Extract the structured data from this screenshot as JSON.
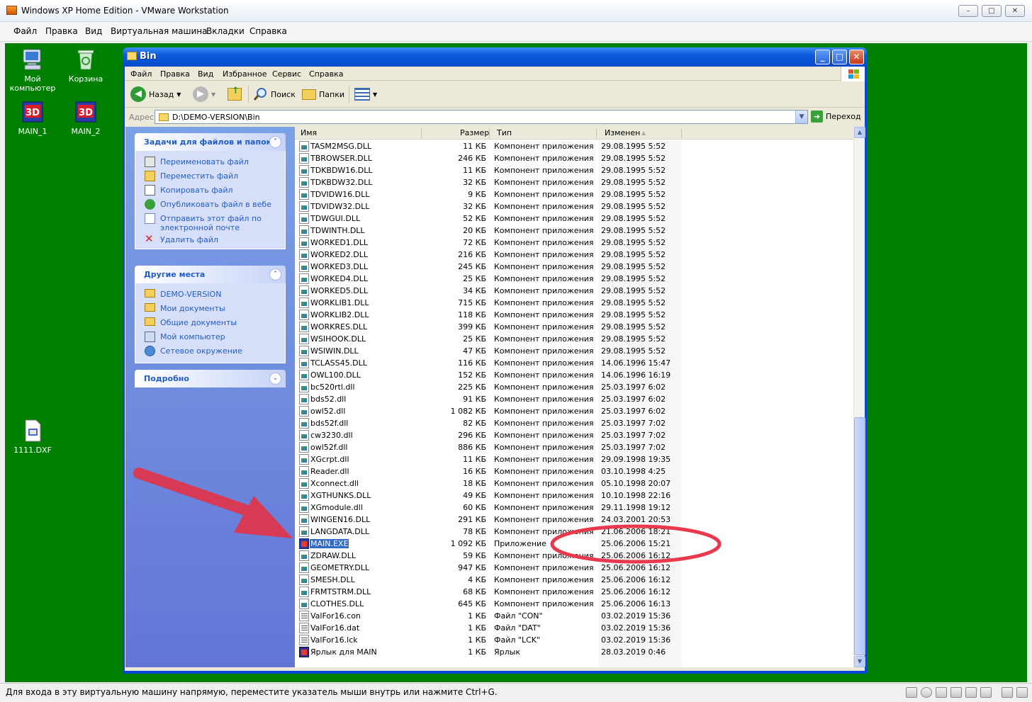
{
  "vm": {
    "title": "Windows XP Home Edition - VMware Workstation",
    "menu": [
      "Файл",
      "Правка",
      "Вид",
      "Виртуальная машина",
      "Вкладки",
      "Справка"
    ],
    "status": "Для входа в эту виртуальную машину напрямую, переместите указатель мыши внутрь или нажмите Ctrl+G."
  },
  "desktop": {
    "icons": [
      {
        "label": "Мой компьютер",
        "icon": "my-computer-icon"
      },
      {
        "label": "Корзина",
        "icon": "recycle-bin-icon"
      },
      {
        "label": "MAIN_1",
        "icon": "3d-app-icon"
      },
      {
        "label": "MAIN_2",
        "icon": "3d-app-icon"
      },
      {
        "label": "1111.DXF",
        "icon": "dxf-file-icon"
      }
    ]
  },
  "explorer": {
    "title": "Bin",
    "menu": [
      "Файл",
      "Правка",
      "Вид",
      "Избранное",
      "Сервис",
      "Справка"
    ],
    "toolbar": {
      "back": "Назад",
      "search": "Поиск",
      "folders": "Папки"
    },
    "address_label": "Адрес:",
    "address": "D:\\DEMO-VERSION\\Bin",
    "go": "Переход",
    "columns": {
      "name": "Имя",
      "size": "Размер",
      "type": "Тип",
      "modified": "Изменен"
    },
    "tasks": {
      "file_tasks": {
        "title": "Задачи для файлов и папок",
        "items": [
          "Переименовать файл",
          "Переместить файл",
          "Копировать файл",
          "Опубликовать файл в вебе",
          "Отправить этот файл по электронной почте",
          "Удалить файл"
        ]
      },
      "other_places": {
        "title": "Другие места",
        "items": [
          "DEMO-VERSION",
          "Мои документы",
          "Общие документы",
          "Мой компьютер",
          "Сетевое окружение"
        ]
      },
      "details": {
        "title": "Подробно"
      }
    },
    "files": [
      {
        "name": "TASM2MSG.DLL",
        "size": "11 КБ",
        "type": "Компонент приложения",
        "modified": "29.08.1995 5:52",
        "kind": "dll"
      },
      {
        "name": "TBROWSER.DLL",
        "size": "246 КБ",
        "type": "Компонент приложения",
        "modified": "29.08.1995 5:52",
        "kind": "dll"
      },
      {
        "name": "TDKBDW16.DLL",
        "size": "11 КБ",
        "type": "Компонент приложения",
        "modified": "29.08.1995 5:52",
        "kind": "dll"
      },
      {
        "name": "TDKBDW32.DLL",
        "size": "32 КБ",
        "type": "Компонент приложения",
        "modified": "29.08.1995 5:52",
        "kind": "dll"
      },
      {
        "name": "TDVIDW16.DLL",
        "size": "9 КБ",
        "type": "Компонент приложения",
        "modified": "29.08.1995 5:52",
        "kind": "dll"
      },
      {
        "name": "TDVIDW32.DLL",
        "size": "32 КБ",
        "type": "Компонент приложения",
        "modified": "29.08.1995 5:52",
        "kind": "dll"
      },
      {
        "name": "TDWGUI.DLL",
        "size": "52 КБ",
        "type": "Компонент приложения",
        "modified": "29.08.1995 5:52",
        "kind": "dll"
      },
      {
        "name": "TDWINTH.DLL",
        "size": "20 КБ",
        "type": "Компонент приложения",
        "modified": "29.08.1995 5:52",
        "kind": "dll"
      },
      {
        "name": "WORKED1.DLL",
        "size": "72 КБ",
        "type": "Компонент приложения",
        "modified": "29.08.1995 5:52",
        "kind": "dll"
      },
      {
        "name": "WORKED2.DLL",
        "size": "216 КБ",
        "type": "Компонент приложения",
        "modified": "29.08.1995 5:52",
        "kind": "dll"
      },
      {
        "name": "WORKED3.DLL",
        "size": "245 КБ",
        "type": "Компонент приложения",
        "modified": "29.08.1995 5:52",
        "kind": "dll"
      },
      {
        "name": "WORKED4.DLL",
        "size": "25 КБ",
        "type": "Компонент приложения",
        "modified": "29.08.1995 5:52",
        "kind": "dll"
      },
      {
        "name": "WORKED5.DLL",
        "size": "34 КБ",
        "type": "Компонент приложения",
        "modified": "29.08.1995 5:52",
        "kind": "dll"
      },
      {
        "name": "WORKLIB1.DLL",
        "size": "715 КБ",
        "type": "Компонент приложения",
        "modified": "29.08.1995 5:52",
        "kind": "dll"
      },
      {
        "name": "WORKLIB2.DLL",
        "size": "118 КБ",
        "type": "Компонент приложения",
        "modified": "29.08.1995 5:52",
        "kind": "dll"
      },
      {
        "name": "WORKRES.DLL",
        "size": "399 КБ",
        "type": "Компонент приложения",
        "modified": "29.08.1995 5:52",
        "kind": "dll"
      },
      {
        "name": "WSIHOOK.DLL",
        "size": "25 КБ",
        "type": "Компонент приложения",
        "modified": "29.08.1995 5:52",
        "kind": "dll"
      },
      {
        "name": "WSIWIN.DLL",
        "size": "47 КБ",
        "type": "Компонент приложения",
        "modified": "29.08.1995 5:52",
        "kind": "dll"
      },
      {
        "name": "TCLASS45.DLL",
        "size": "116 КБ",
        "type": "Компонент приложения",
        "modified": "14.06.1996 15:47",
        "kind": "dll"
      },
      {
        "name": "OWL100.DLL",
        "size": "152 КБ",
        "type": "Компонент приложения",
        "modified": "14.06.1996 16:19",
        "kind": "dll"
      },
      {
        "name": "bc520rtl.dll",
        "size": "225 КБ",
        "type": "Компонент приложения",
        "modified": "25.03.1997 6:02",
        "kind": "dll"
      },
      {
        "name": "bds52.dll",
        "size": "91 КБ",
        "type": "Компонент приложения",
        "modified": "25.03.1997 6:02",
        "kind": "dll"
      },
      {
        "name": "owl52.dll",
        "size": "1 082 КБ",
        "type": "Компонент приложения",
        "modified": "25.03.1997 6:02",
        "kind": "dll"
      },
      {
        "name": "bds52f.dll",
        "size": "82 КБ",
        "type": "Компонент приложения",
        "modified": "25.03.1997 7:02",
        "kind": "dll"
      },
      {
        "name": "cw3230.dll",
        "size": "296 КБ",
        "type": "Компонент приложения",
        "modified": "25.03.1997 7:02",
        "kind": "dll"
      },
      {
        "name": "owl52f.dll",
        "size": "886 КБ",
        "type": "Компонент приложения",
        "modified": "25.03.1997 7:02",
        "kind": "dll"
      },
      {
        "name": "XGcrpt.dll",
        "size": "11 КБ",
        "type": "Компонент приложения",
        "modified": "29.09.1998 19:35",
        "kind": "dll"
      },
      {
        "name": "Reader.dll",
        "size": "16 КБ",
        "type": "Компонент приложения",
        "modified": "03.10.1998 4:25",
        "kind": "dll"
      },
      {
        "name": "Xconnect.dll",
        "size": "18 КБ",
        "type": "Компонент приложения",
        "modified": "05.10.1998 20:07",
        "kind": "dll"
      },
      {
        "name": "XGTHUNKS.DLL",
        "size": "49 КБ",
        "type": "Компонент приложения",
        "modified": "10.10.1998 22:16",
        "kind": "dll"
      },
      {
        "name": "XGmodule.dll",
        "size": "60 КБ",
        "type": "Компонент приложения",
        "modified": "29.11.1998 19:12",
        "kind": "dll"
      },
      {
        "name": "WINGEN16.DLL",
        "size": "291 КБ",
        "type": "Компонент приложения",
        "modified": "24.03.2001 20:53",
        "kind": "dll"
      },
      {
        "name": "LANGDATA.DLL",
        "size": "78 КБ",
        "type": "Компонент приложения",
        "modified": "21.06.2006 18:21",
        "kind": "dll"
      },
      {
        "name": "MAIN.EXE",
        "size": "1 092 КБ",
        "type": "Приложение",
        "modified": "25.06.2006 15:21",
        "kind": "exe",
        "selected": true
      },
      {
        "name": "ZDRAW.DLL",
        "size": "59 КБ",
        "type": "Компонент приложения",
        "modified": "25.06.2006 16:12",
        "kind": "dll"
      },
      {
        "name": "GEOMETRY.DLL",
        "size": "947 КБ",
        "type": "Компонент приложения",
        "modified": "25.06.2006 16:12",
        "kind": "dll"
      },
      {
        "name": "SMESH.DLL",
        "size": "4 КБ",
        "type": "Компонент приложения",
        "modified": "25.06.2006 16:12",
        "kind": "dll"
      },
      {
        "name": "FRMTSTRM.DLL",
        "size": "68 КБ",
        "type": "Компонент приложения",
        "modified": "25.06.2006 16:12",
        "kind": "dll"
      },
      {
        "name": "CLOTHES.DLL",
        "size": "645 КБ",
        "type": "Компонент приложения",
        "modified": "25.06.2006 16:13",
        "kind": "dll"
      },
      {
        "name": "ValFor16.con",
        "size": "1 КБ",
        "type": "Файл \"CON\"",
        "modified": "03.02.2019 15:36",
        "kind": "txt"
      },
      {
        "name": "ValFor16.dat",
        "size": "1 КБ",
        "type": "Файл \"DAT\"",
        "modified": "03.02.2019 15:36",
        "kind": "txt"
      },
      {
        "name": "ValFor16.lck",
        "size": "1 КБ",
        "type": "Файл \"LCK\"",
        "modified": "03.02.2019 15:36",
        "kind": "txt"
      },
      {
        "name": "Ярлык для MAIN",
        "size": "1 КБ",
        "type": "Ярлык",
        "modified": "28.03.2019 0:46",
        "kind": "lnk"
      }
    ]
  },
  "annotations": {
    "arrow_color": "#d63a55",
    "circle_color": "#e8394d"
  }
}
